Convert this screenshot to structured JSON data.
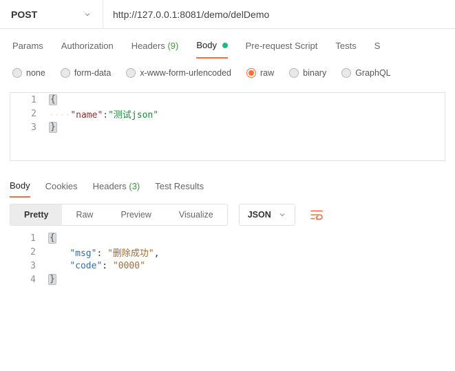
{
  "request": {
    "method": "POST",
    "url": "http://127.0.0.1:8081/demo/delDemo"
  },
  "reqTabs": {
    "params": "Params",
    "auth": "Authorization",
    "headers_label": "Headers",
    "headers_count": "(9)",
    "body": "Body",
    "prerequest": "Pre-request Script",
    "tests": "Tests",
    "settings_partial": "S"
  },
  "bodyTypes": {
    "none": "none",
    "formdata": "form-data",
    "urlencoded": "x-www-form-urlencoded",
    "raw": "raw",
    "binary": "binary",
    "graphql": "GraphQL"
  },
  "reqBody": {
    "l1": "{",
    "l2_dots": "····",
    "l2_key": "\"name\"",
    "l2_colon": ":",
    "l2_val": "\"测试json\"",
    "l3": "}"
  },
  "respTabs": {
    "body": "Body",
    "cookies": "Cookies",
    "headers_label": "Headers",
    "headers_count": "(3)",
    "testresults": "Test Results"
  },
  "respBar": {
    "pretty": "Pretty",
    "raw": "Raw",
    "preview": "Preview",
    "visualize": "Visualize",
    "format": "JSON"
  },
  "respBody": {
    "l1": "{",
    "l2_key": "\"msg\"",
    "l2_sep": ": ",
    "l2_val": "\"删除成功\"",
    "l2_comma": ",",
    "l3_key": "\"code\"",
    "l3_sep": ": ",
    "l3_val": "\"0000\"",
    "l4": "}",
    "indent": "    "
  },
  "lineNumbers": {
    "n1": "1",
    "n2": "2",
    "n3": "3",
    "n4": "4"
  }
}
